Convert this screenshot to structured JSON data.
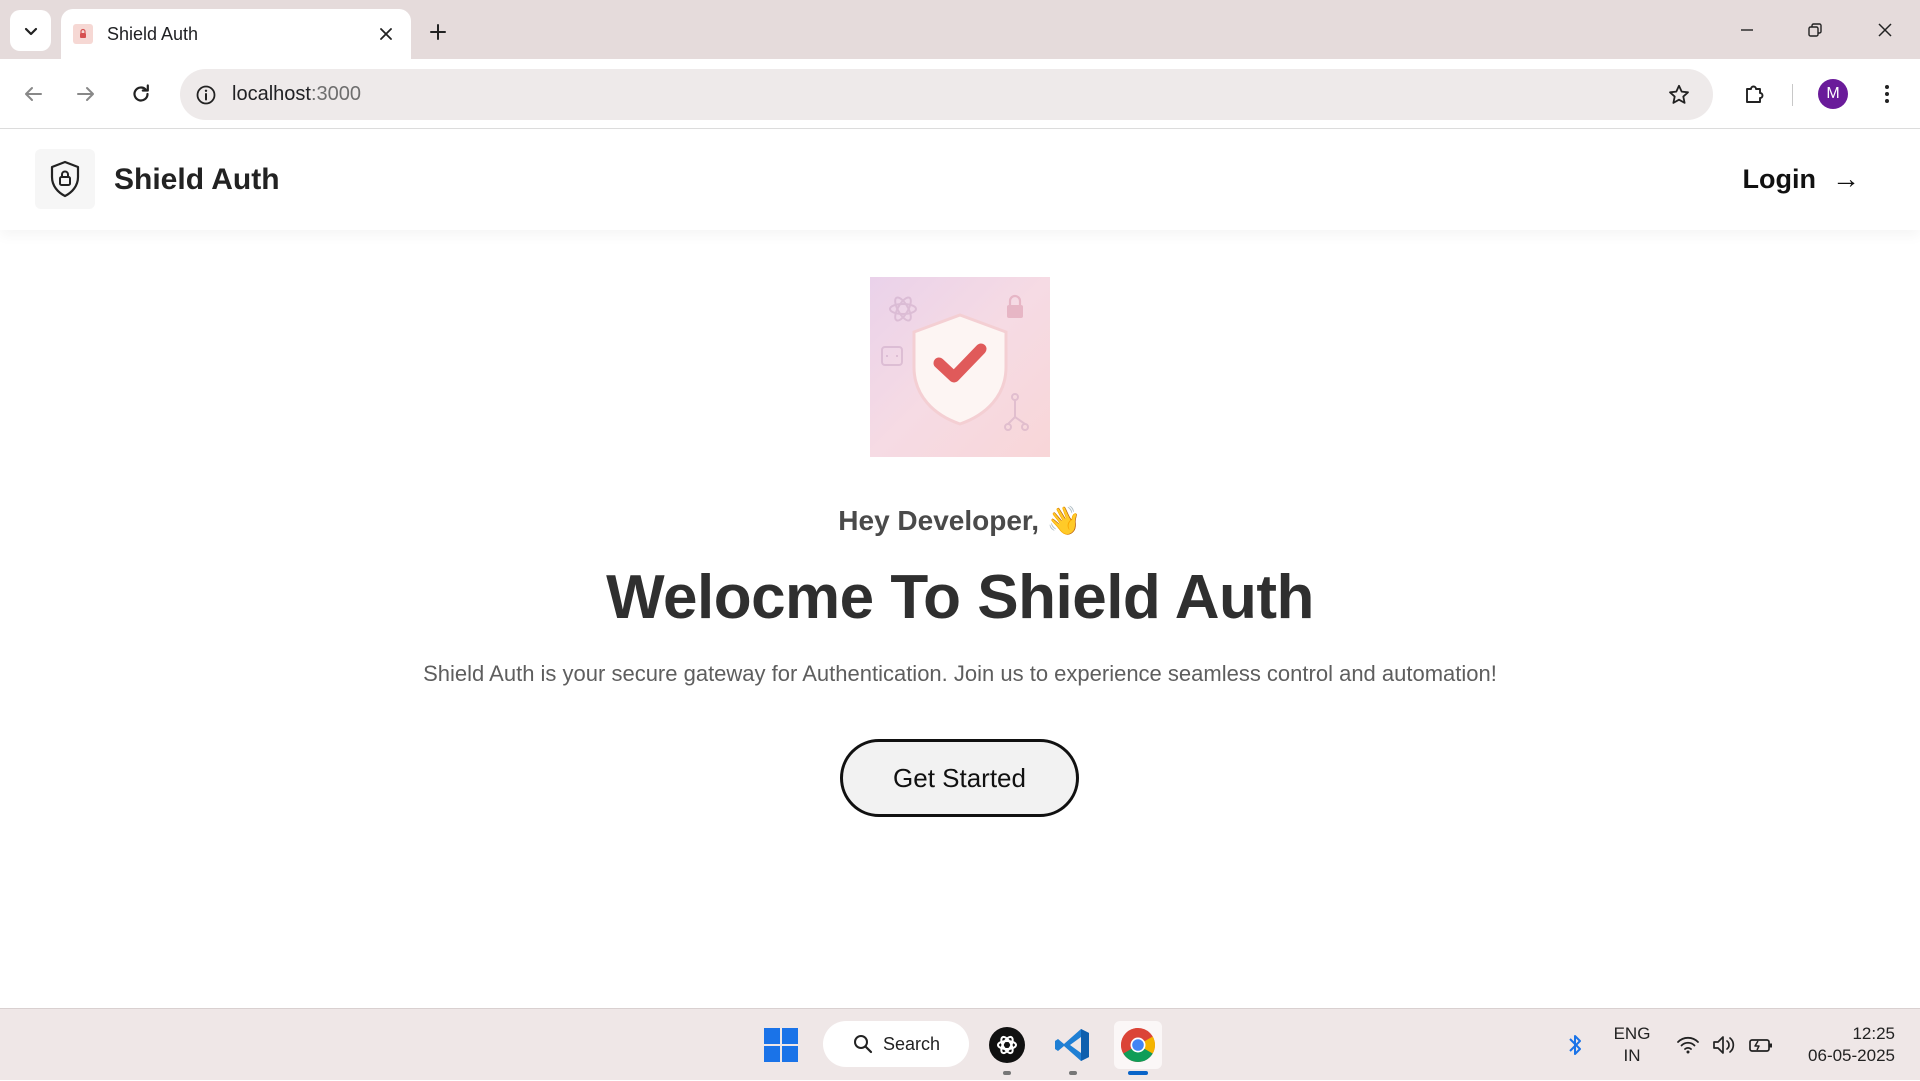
{
  "browser": {
    "tab": {
      "title": "Shield Auth"
    },
    "url": {
      "host": "localhost",
      "port": ":3000"
    },
    "profile_initial": "M"
  },
  "page": {
    "nav": {
      "brand": "Shield Auth",
      "login_label": "Login",
      "login_arrow": "→"
    },
    "hero": {
      "greeting": "Hey Developer, 👋",
      "headline": "Welocme To Shield Auth",
      "subtitle": "Shield Auth is your secure gateway for Authentication. Join us to experience seamless control and automation!",
      "cta_label": "Get Started"
    }
  },
  "taskbar": {
    "search_label": "Search",
    "apps": [
      "start-icon",
      "chatgpt-icon",
      "vscode-icon",
      "chrome-icon"
    ],
    "lang_line1": "ENG",
    "lang_line2": "IN",
    "time": "12:25",
    "date": "06-05-2025"
  },
  "colors": {
    "headline": "#2f2f2f",
    "profile": "#6a1b9a",
    "shield_check": "#e05a5a",
    "chrome_indicator": "#0a64c8"
  }
}
